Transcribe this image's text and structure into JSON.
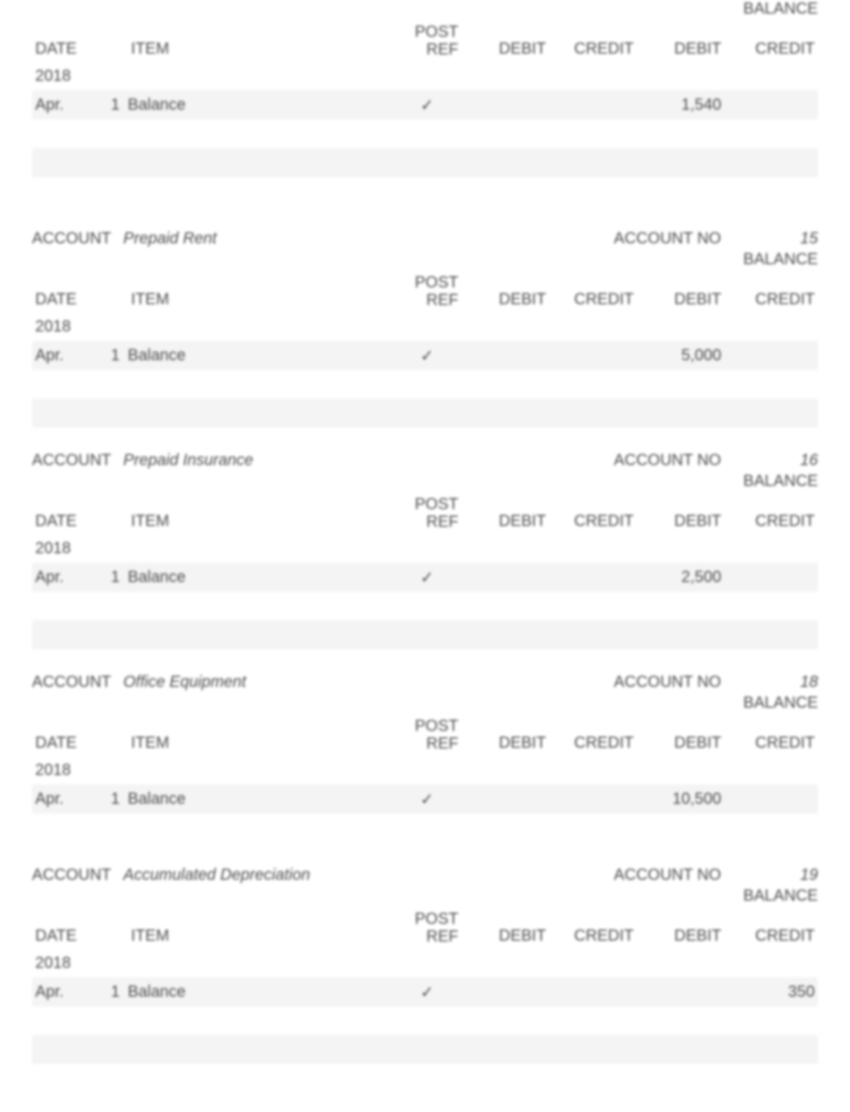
{
  "labels": {
    "account": "ACCOUNT",
    "account_no": "ACCOUNT NO",
    "balance": "BALANCE",
    "date": "DATE",
    "item": "ITEM",
    "post_ref": "POST REF",
    "debit": "DEBIT",
    "credit": "CREDIT",
    "check": "✓"
  },
  "ledgers": [
    {
      "name": "",
      "number": "",
      "show_header": false,
      "rows": [
        {
          "year": "2018",
          "month": "",
          "day": "",
          "item": "",
          "ref": "",
          "debit": "",
          "credit": "",
          "bdebit": "",
          "bcredit": ""
        },
        {
          "year": "",
          "month": "Apr.",
          "day": "1",
          "item": "Balance",
          "ref": "✓",
          "debit": "",
          "credit": "",
          "bdebit": "1,540",
          "bcredit": ""
        },
        {
          "year": "",
          "month": "",
          "day": "",
          "item": "",
          "ref": "",
          "debit": "",
          "credit": "",
          "bdebit": "",
          "bcredit": ""
        },
        {
          "year": "",
          "month": "",
          "day": "",
          "item": "",
          "ref": "",
          "debit": "",
          "credit": "",
          "bdebit": "",
          "bcredit": ""
        },
        {
          "year": "",
          "month": "",
          "day": "",
          "item": "",
          "ref": "",
          "debit": "",
          "credit": "",
          "bdebit": "",
          "bcredit": ""
        }
      ]
    },
    {
      "name": "Prepaid Rent",
      "number": "15",
      "show_header": true,
      "rows": [
        {
          "year": "2018",
          "month": "",
          "day": "",
          "item": "",
          "ref": "",
          "debit": "",
          "credit": "",
          "bdebit": "",
          "bcredit": ""
        },
        {
          "year": "",
          "month": "Apr.",
          "day": "1",
          "item": "Balance",
          "ref": "✓",
          "debit": "",
          "credit": "",
          "bdebit": "5,000",
          "bcredit": ""
        },
        {
          "year": "",
          "month": "",
          "day": "",
          "item": "",
          "ref": "",
          "debit": "",
          "credit": "",
          "bdebit": "",
          "bcredit": ""
        },
        {
          "year": "",
          "month": "",
          "day": "",
          "item": "",
          "ref": "",
          "debit": "",
          "credit": "",
          "bdebit": "",
          "bcredit": ""
        }
      ]
    },
    {
      "name": "Prepaid Insurance",
      "number": "16",
      "show_header": true,
      "rows": [
        {
          "year": "2018",
          "month": "",
          "day": "",
          "item": "",
          "ref": "",
          "debit": "",
          "credit": "",
          "bdebit": "",
          "bcredit": ""
        },
        {
          "year": "",
          "month": "Apr.",
          "day": "1",
          "item": "Balance",
          "ref": "✓",
          "debit": "",
          "credit": "",
          "bdebit": "2,500",
          "bcredit": ""
        },
        {
          "year": "",
          "month": "",
          "day": "",
          "item": "",
          "ref": "",
          "debit": "",
          "credit": "",
          "bdebit": "",
          "bcredit": ""
        },
        {
          "year": "",
          "month": "",
          "day": "",
          "item": "",
          "ref": "",
          "debit": "",
          "credit": "",
          "bdebit": "",
          "bcredit": ""
        }
      ]
    },
    {
      "name": "Office Equipment",
      "number": "18",
      "show_header": true,
      "rows": [
        {
          "year": "2018",
          "month": "",
          "day": "",
          "item": "",
          "ref": "",
          "debit": "",
          "credit": "",
          "bdebit": "",
          "bcredit": ""
        },
        {
          "year": "",
          "month": "Apr.",
          "day": "1",
          "item": "Balance",
          "ref": "✓",
          "debit": "",
          "credit": "",
          "bdebit": "10,500",
          "bcredit": ""
        },
        {
          "year": "",
          "month": "",
          "day": "",
          "item": "",
          "ref": "",
          "debit": "",
          "credit": "",
          "bdebit": "",
          "bcredit": ""
        }
      ]
    },
    {
      "name": "Accumulated Depreciation",
      "number": "19",
      "show_header": true,
      "rows": [
        {
          "year": "2018",
          "month": "",
          "day": "",
          "item": "",
          "ref": "",
          "debit": "",
          "credit": "",
          "bdebit": "",
          "bcredit": ""
        },
        {
          "year": "",
          "month": "Apr.",
          "day": "1",
          "item": "Balance",
          "ref": "✓",
          "debit": "",
          "credit": "",
          "bdebit": "",
          "bcredit": "350"
        },
        {
          "year": "",
          "month": "",
          "day": "",
          "item": "",
          "ref": "",
          "debit": "",
          "credit": "",
          "bdebit": "",
          "bcredit": ""
        },
        {
          "year": "",
          "month": "",
          "day": "",
          "item": "",
          "ref": "",
          "debit": "",
          "credit": "",
          "bdebit": "",
          "bcredit": ""
        }
      ]
    }
  ]
}
